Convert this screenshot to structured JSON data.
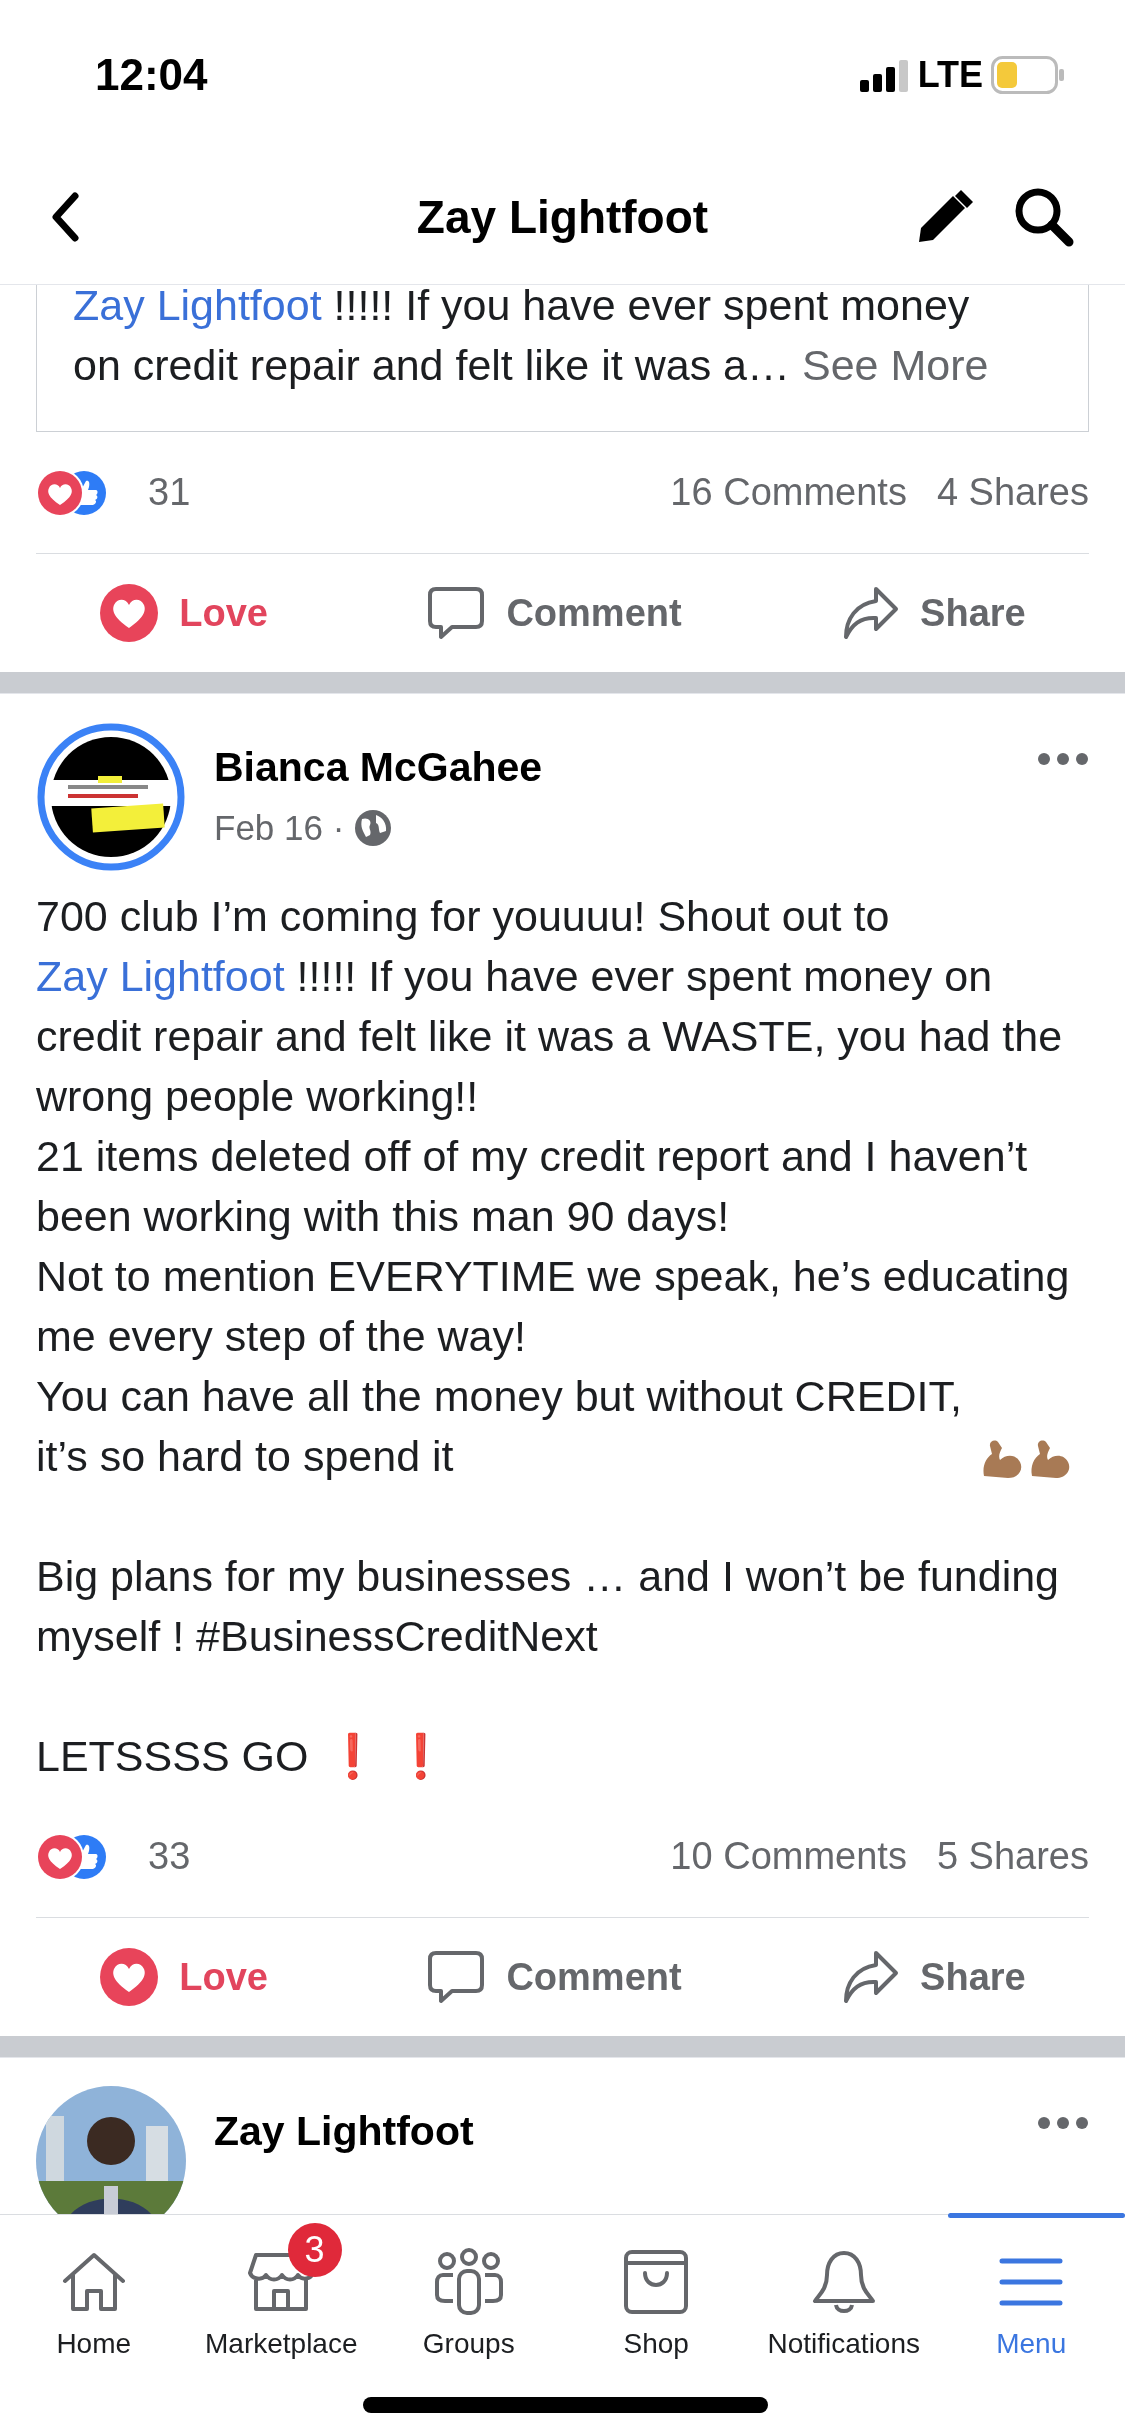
{
  "status_bar": {
    "time": "12:04",
    "network": "LTE"
  },
  "header": {
    "title": "Zay Lightfoot"
  },
  "posts": [
    {
      "kind": "partial",
      "shared_lines": [
        [
          {
            "kind": "mention",
            "text": "Zay Lightfoot"
          },
          {
            "kind": "text",
            "text": " !!!!! If you have ever spent money"
          }
        ],
        [
          {
            "kind": "text",
            "text": "on credit repair and felt like it was a… "
          },
          {
            "kind": "more",
            "text": "See More"
          }
        ]
      ],
      "reaction_count": "31",
      "comments": "16 Comments",
      "shares": "4 Shares",
      "actions": [
        {
          "kind": "love",
          "label": "Love",
          "selected": true
        },
        {
          "kind": "comment",
          "label": "Comment",
          "selected": false
        },
        {
          "kind": "share",
          "label": "Share",
          "selected": false
        }
      ]
    },
    {
      "kind": "full",
      "author": "Bianca McGahee",
      "date": "Feb 16 ·",
      "paragraphs": [
        {
          "kind": "text",
          "segments": [
            {
              "kind": "text",
              "text": "700 club I’m coming for youuuu! Shout out to "
            },
            {
              "kind": "mention",
              "text": "Zay Lightfoot"
            },
            {
              "kind": "text",
              "text": " !!!!! If you have ever spent money on credit repair and felt like it was a WASTE, you had the wrong people working!!"
            }
          ]
        },
        {
          "kind": "text",
          "segments": [
            {
              "kind": "text",
              "text": "21 items deleted off of my credit report and I haven’t been working with this man 90 days!"
            }
          ]
        },
        {
          "kind": "text",
          "segments": [
            {
              "kind": "text",
              "text": "Not to mention EVERYTIME we speak, he’s educating me every step of the way!"
            }
          ]
        },
        {
          "kind": "flex",
          "segments": [
            {
              "kind": "text",
              "text": "You can have all the money but without CREDIT, it’s so hard to spend it"
            }
          ]
        },
        {
          "kind": "gap"
        },
        {
          "kind": "text",
          "segments": [
            {
              "kind": "text",
              "text": "Big plans for my businesses … and I won’t be funding myself ! #BusinessCreditNext"
            }
          ]
        },
        {
          "kind": "gap"
        },
        {
          "kind": "exclaim",
          "segments": [
            {
              "kind": "text",
              "text": "LETSSSS GO"
            }
          ],
          "marks": "❗ ❗"
        }
      ],
      "reaction_count": "33",
      "comments": "10 Comments",
      "shares": "5 Shares",
      "actions": [
        {
          "kind": "love",
          "label": "Love",
          "selected": true
        },
        {
          "kind": "comment",
          "label": "Comment",
          "selected": false
        },
        {
          "kind": "share",
          "label": "Share",
          "selected": false
        }
      ]
    },
    {
      "kind": "cut",
      "author": "Zay Lightfoot"
    }
  ],
  "nav": [
    {
      "kind": "home",
      "label": "Home",
      "selected": false
    },
    {
      "kind": "marketplace",
      "label": "Marketplace",
      "selected": false,
      "badge": "3"
    },
    {
      "kind": "groups",
      "label": "Groups",
      "selected": false
    },
    {
      "kind": "shop",
      "label": "Shop",
      "selected": false
    },
    {
      "kind": "notifications",
      "label": "Notifications",
      "selected": false
    },
    {
      "kind": "menu",
      "label": "Menu",
      "selected": true
    }
  ]
}
